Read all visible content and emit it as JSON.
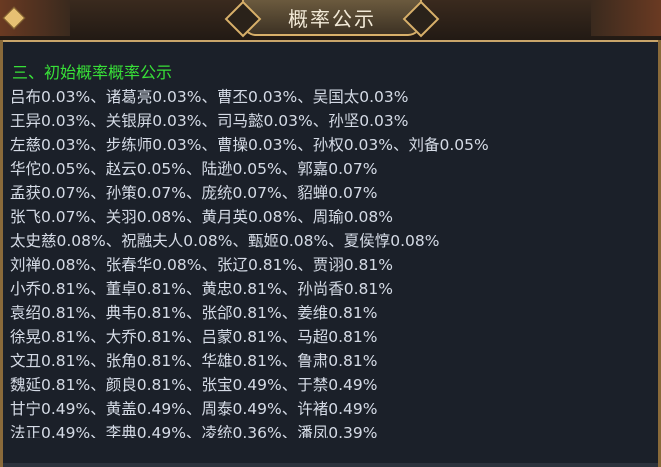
{
  "window": {
    "title": "概率公示"
  },
  "section": {
    "heading": "三、初始概率概率公示"
  },
  "lines": [
    "吕布0.03%、诸葛亮0.03%、曹丕0.03%、吴国太0.03%",
    "王异0.03%、关银屏0.03%、司马懿0.03%、孙坚0.03%",
    "左慈0.03%、步练师0.03%、曹操0.03%、孙权0.03%、刘备0.05%",
    "华佗0.05%、赵云0.05%、陆逊0.05%、郭嘉0.07%",
    "孟获0.07%、孙策0.07%、庞统0.07%、貂蝉0.07%",
    "张飞0.07%、关羽0.08%、黄月英0.08%、周瑜0.08%",
    "太史慈0.08%、祝融夫人0.08%、甄姬0.08%、夏侯惇0.08%",
    "刘禅0.08%、张春华0.08%、张辽0.81%、贾诩0.81%",
    "小乔0.81%、董卓0.81%、黄忠0.81%、孙尚香0.81%",
    "袁绍0.81%、典韦0.81%、张郃0.81%、姜维0.81%",
    "徐晃0.81%、大乔0.81%、吕蒙0.81%、马超0.81%",
    "文丑0.81%、张角0.81%、华雄0.81%、鲁肃0.81%",
    "魏延0.81%、颜良0.81%、张宝0.49%、于禁0.49%",
    "甘宁0.49%、黄盖0.49%、周泰0.49%、许褚0.49%",
    "法正0.49%、李典0.49%、凌统0.36%、潘凤0.39%"
  ],
  "colors": {
    "heading": "#38e038",
    "text": "#d5dbe6",
    "background": "#1b2029",
    "frame_gold": "#d8b06a"
  }
}
